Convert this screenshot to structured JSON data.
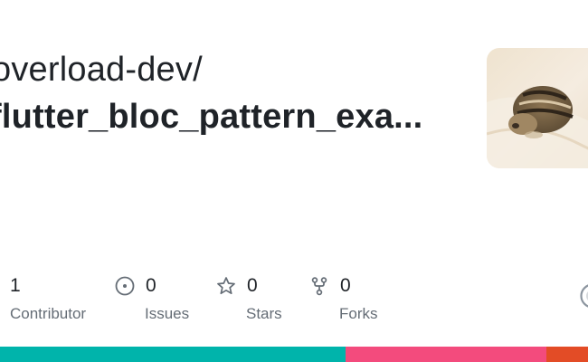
{
  "repo": {
    "owner": "overload-dev/",
    "name": "flutter_bloc_pattern_exa..."
  },
  "avatar": {
    "description_icon": "chipmunk-avatar"
  },
  "stats": [
    {
      "key": "contributors",
      "value": "1",
      "label": "Contributor",
      "icon": "people-icon"
    },
    {
      "key": "issues",
      "value": "0",
      "label": "Issues",
      "icon": "issue-opened-icon"
    },
    {
      "key": "stars",
      "value": "0",
      "label": "Stars",
      "icon": "star-icon"
    },
    {
      "key": "forks",
      "value": "0",
      "label": "Forks",
      "icon": "repo-forked-icon"
    }
  ],
  "languages": [
    {
      "color": "#00b4ab",
      "fraction": 0.587
    },
    {
      "color": "#f34b7d",
      "fraction": 0.342
    },
    {
      "color": "#e34c26",
      "fraction": 0.071
    }
  ],
  "colors": {
    "text": "#1f2328",
    "muted": "#656d76",
    "icon": "#656d76"
  }
}
